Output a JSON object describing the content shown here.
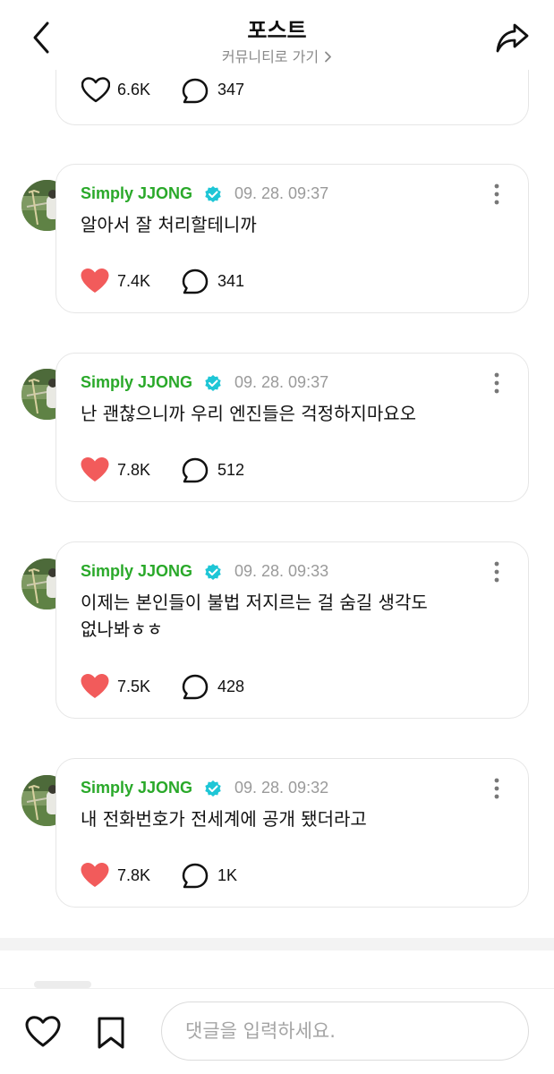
{
  "header": {
    "title": "포스트",
    "subtitle": "커뮤니티로 가기"
  },
  "colors": {
    "accent_green": "#2aa92a",
    "verified_blue": "#1ec6d6",
    "like_red": "#f25b5b"
  },
  "top_card": {
    "likes": "6.6K",
    "comments": "347",
    "liked": false
  },
  "posts": [
    {
      "author": "Simply JJONG",
      "time": "09. 28. 09:37",
      "text": "알아서 잘 처리할테니까",
      "likes": "7.4K",
      "comments": "341",
      "liked": true
    },
    {
      "author": "Simply JJONG",
      "time": "09. 28. 09:37",
      "text": "난 괜찮으니까 우리 엔진들은 걱정하지마요오",
      "likes": "7.8K",
      "comments": "512",
      "liked": true
    },
    {
      "author": "Simply JJONG",
      "time": "09. 28. 09:33",
      "text_line1": "이제는 본인들이 불법 저지르는 걸 숨길 생각도",
      "text_line2": "없나봐ㅎㅎ",
      "likes": "7.5K",
      "comments": "428",
      "liked": true
    },
    {
      "author": "Simply JJONG",
      "time": "09. 28. 09:32",
      "text": "내 전화번호가 전세계에 공개 됐더라고",
      "likes": "7.8K",
      "comments": "1K",
      "liked": true
    }
  ],
  "bottom_bar": {
    "comment_placeholder": "댓글을 입력하세요."
  },
  "icons": [
    "back-arrow-icon",
    "share-icon",
    "heart-icon",
    "comment-bubble-icon",
    "verified-badge-icon",
    "more-vertical-icon",
    "bookmark-icon",
    "chevron-right-icon"
  ]
}
